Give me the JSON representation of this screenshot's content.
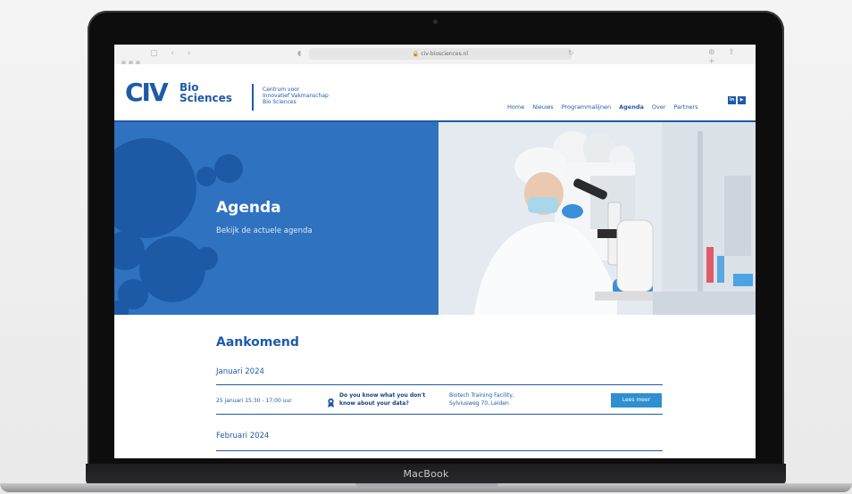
{
  "device": {
    "brand": "MacBook"
  },
  "browser": {
    "url": "civ-biosciences.nl"
  },
  "site": {
    "logo_mark": "CIV",
    "logo_line1": "Bio",
    "logo_line2": "Sciences",
    "tagline_1": "Centrum voor",
    "tagline_2": "Innovatief Vakmanschap",
    "tagline_3": "Bio Sciences",
    "nav": [
      "Home",
      "Nieuws",
      "Programmalijnen",
      "Agenda",
      "Over",
      "Partners"
    ],
    "active_nav": "Agenda",
    "social": [
      "in",
      "▶"
    ]
  },
  "hero": {
    "title": "Agenda",
    "subtitle": "Bekijk de actuele agenda"
  },
  "agenda": {
    "heading": "Aankomend",
    "months": [
      "Januari 2024",
      "Februari 2024"
    ],
    "events": [
      {
        "date": "25 januari 15:30 - 17:00 uur",
        "title_1": "Do you know what you don't",
        "title_2": "know about your data?",
        "location_1": "Biotech Training Facility,",
        "location_2": "Sylviusweg 70, Leiden",
        "button": "Lees meer"
      }
    ]
  },
  "colors": {
    "brand_blue": "#1e5aa8",
    "hero_blue": "#2f72c0",
    "button_blue": "#2f8fd0"
  }
}
